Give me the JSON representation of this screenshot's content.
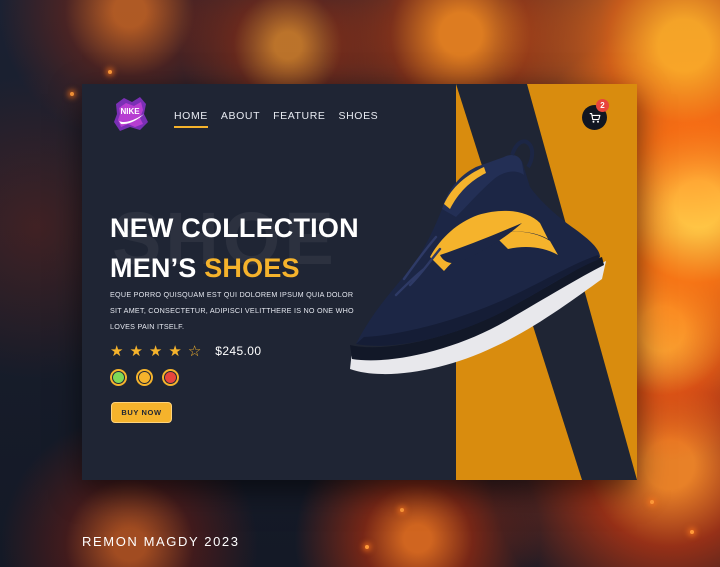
{
  "brand": {
    "logo_text": "NIKE"
  },
  "nav": {
    "items": [
      {
        "label": "HOME",
        "active": true
      },
      {
        "label": "ABOUT",
        "active": false
      },
      {
        "label": "FEATURE",
        "active": false
      },
      {
        "label": "SHOES",
        "active": false
      }
    ]
  },
  "cart": {
    "icon": "cart-icon",
    "count": "2"
  },
  "hero": {
    "watermark": "SHOE",
    "title_line1": "NEW COLLECTION",
    "title_line2_prefix": "MEN’S ",
    "title_line2_accent": "SHOES",
    "description": "EQUE PORRO QUISQUAM EST QUI DOLOREM IPSUM QUIA DOLOR SIT AMET, CONSECTETUR, ADIPISCI VELITTHERE IS NO ONE WHO LOVES PAIN ITSELF.",
    "rating": 4,
    "rating_max": 5,
    "price": "$245.00",
    "color_options": [
      "#7ed957",
      "#f5b32c",
      "#e8453c"
    ],
    "buy_label": "BUY NOW"
  },
  "credit": "REMON MAGDY 2023",
  "colors": {
    "accent": "#f5b32c",
    "card_bg": "#1f2534",
    "panel_orange": "#d98c0e"
  }
}
